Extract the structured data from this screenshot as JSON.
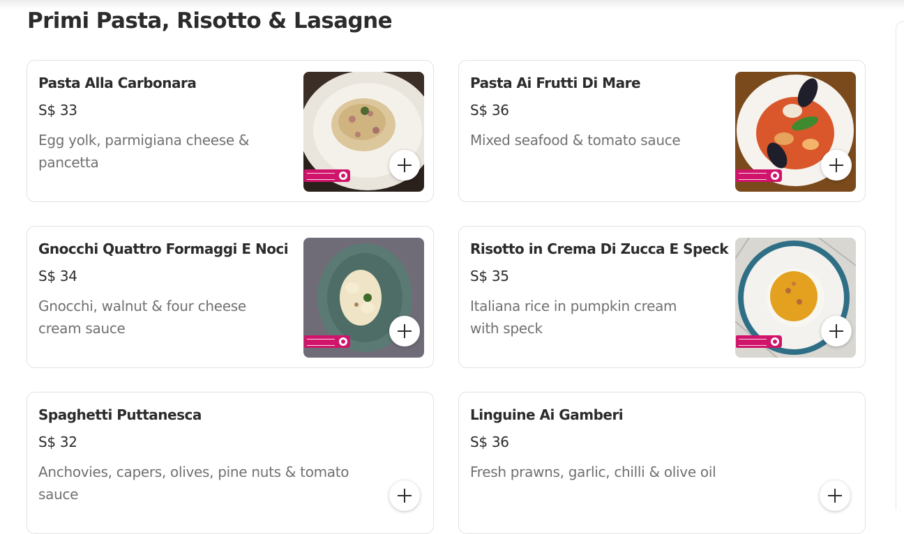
{
  "section": {
    "title": "Primi Pasta, Risotto & Lasagne"
  },
  "colors": {
    "badge": "#d1146b",
    "text": "#2b2b2b",
    "muted": "#707070"
  },
  "items": [
    {
      "name": "Pasta Alla Carbonara",
      "price": "S$ 33",
      "description": "Egg yolk, parmigiana cheese & pancetta",
      "has_photo": true,
      "add_icon": "plus-icon"
    },
    {
      "name": "Pasta Ai Frutti Di Mare",
      "price": "S$ 36",
      "description": "Mixed seafood & tomato sauce",
      "has_photo": true,
      "add_icon": "plus-icon"
    },
    {
      "name": "Gnocchi Quattro Formaggi E Noci",
      "price": "S$ 34",
      "description": "Gnocchi, walnut & four cheese cream sauce",
      "has_photo": true,
      "add_icon": "plus-icon"
    },
    {
      "name": "Risotto in Crema Di Zucca E Speck",
      "price": "S$ 35",
      "description": "Italiana rice in pumpkin cream with speck",
      "has_photo": true,
      "add_icon": "plus-icon"
    },
    {
      "name": "Spaghetti Puttanesca",
      "price": "S$ 32",
      "description": "Anchovies, capers, olives, pine nuts & tomato sauce",
      "has_photo": false,
      "add_icon": "plus-icon"
    },
    {
      "name": "Linguine Ai Gamberi",
      "price": "S$ 36",
      "description": "Fresh prawns, garlic, chilli & olive oil",
      "has_photo": false,
      "add_icon": "plus-icon"
    }
  ]
}
